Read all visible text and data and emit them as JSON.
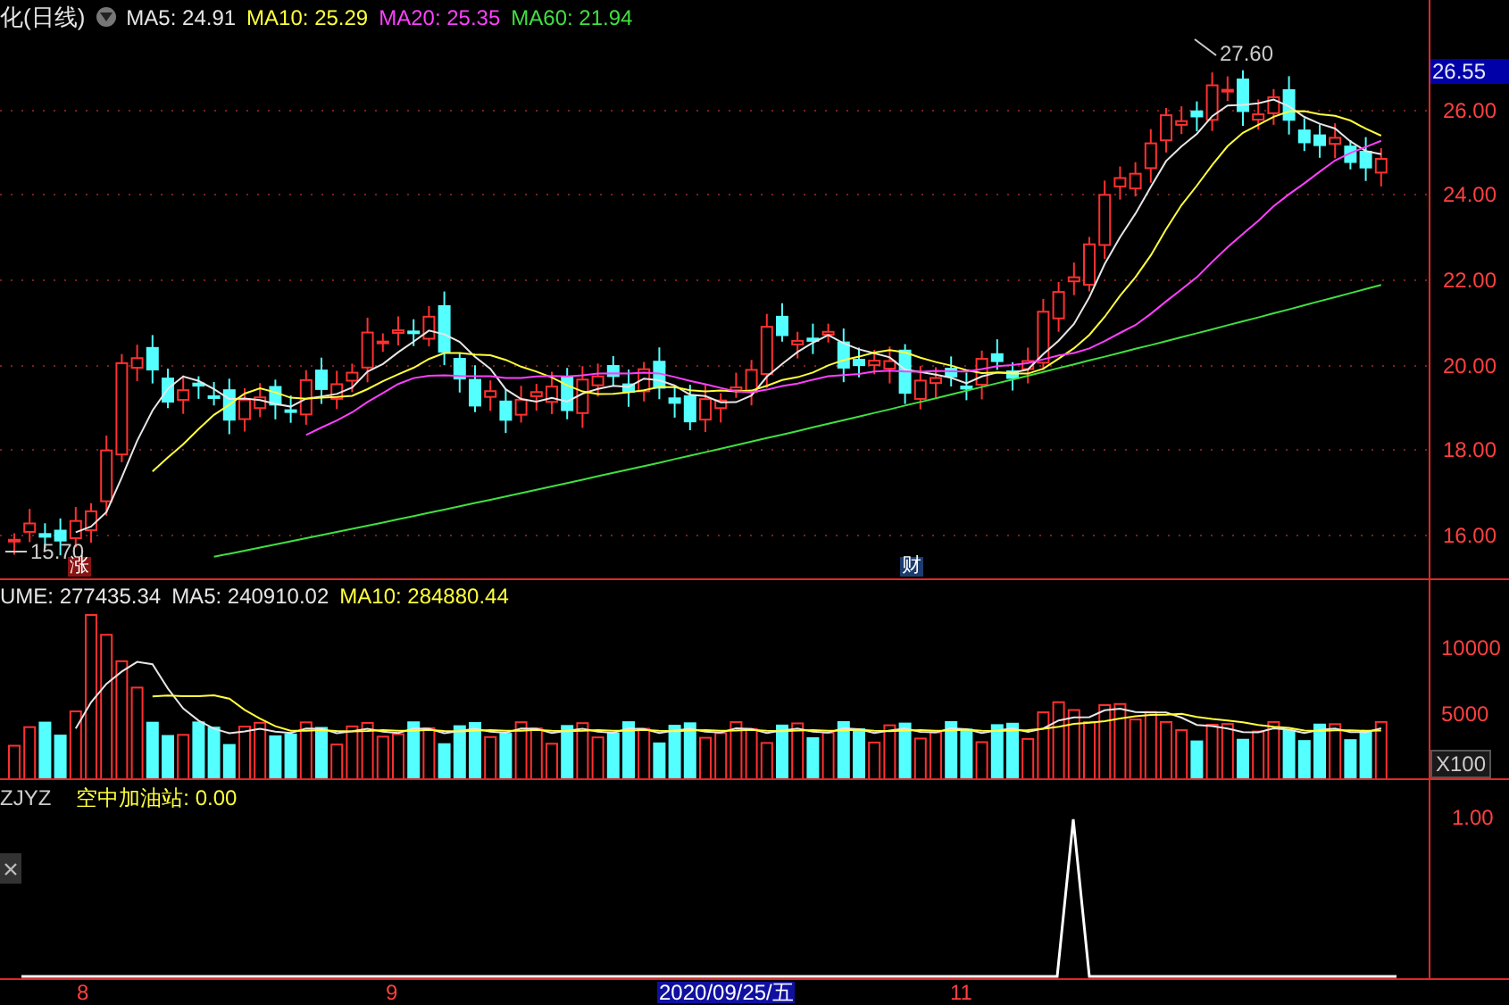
{
  "header": {
    "title": "化(日线)",
    "ma": [
      {
        "label": "MA5: 24.91",
        "color": "#e6e6e6"
      },
      {
        "label": "MA10: 25.29",
        "color": "#ffff3c"
      },
      {
        "label": "MA20: 25.35",
        "color": "#ff40ff"
      },
      {
        "label": "MA60: 21.94",
        "color": "#40e040"
      }
    ]
  },
  "price_axis": {
    "current": "26.55",
    "ticks": [
      "26.00",
      "24.00",
      "22.00",
      "20.00",
      "18.00",
      "16.00"
    ]
  },
  "price_chart": {
    "high_label": "27.60",
    "low_label": "15.70",
    "markers": [
      {
        "text": "涨",
        "color": "#8a1414"
      },
      {
        "text": "财",
        "color": "#1c3c6e"
      }
    ]
  },
  "volume": {
    "header": [
      {
        "label": "UME: 277435.34",
        "color": "#e6e6e6"
      },
      {
        "label": "MA5: 240910.02",
        "color": "#e6e6e6"
      },
      {
        "label": "MA10: 284880.44",
        "color": "#ffff3c"
      }
    ],
    "ticks": [
      "10000",
      "5000"
    ],
    "unit": "X100"
  },
  "indicator": {
    "name": "ZJYZ",
    "reading": "空中加油站: 0.00",
    "ticks": [
      "1.00"
    ]
  },
  "x_axis": [
    {
      "label": "8",
      "selected": false
    },
    {
      "label": "9",
      "selected": false
    },
    {
      "label": "2020/09/25/五",
      "selected": true
    },
    {
      "label": "11",
      "selected": false
    }
  ]
}
